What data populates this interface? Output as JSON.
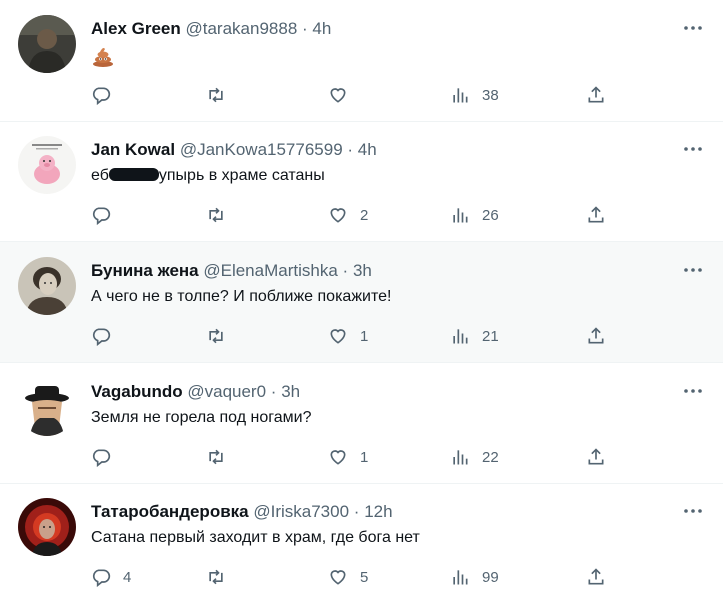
{
  "tweets": [
    {
      "name": "Alex Green",
      "handle": "@tarakan9888",
      "sep": "·",
      "time": "4h",
      "text": "",
      "emoji": "poop-emoji",
      "replies": "",
      "likes": "",
      "views": "38",
      "shaded": false
    },
    {
      "name": "Jan Kowal",
      "handle": "@JanKowa15776599",
      "sep": "·",
      "time": "4h",
      "text_before": "еб",
      "text_after": "упырь в храме сатаны",
      "replies": "",
      "likes": "2",
      "views": "26",
      "shaded": false
    },
    {
      "name": "Бунина жена",
      "handle": "@ElenaMartishka",
      "sep": "·",
      "time": "3h",
      "text": "А чего не в толпе? И поближе покажите!",
      "replies": "",
      "likes": "1",
      "views": "21",
      "shaded": true
    },
    {
      "name": "Vagabundo",
      "handle": "@vaquer0",
      "sep": "·",
      "time": "3h",
      "text": "Земля не горела под ногами?",
      "replies": "",
      "likes": "1",
      "views": "22",
      "shaded": false
    },
    {
      "name": "Татаробандеровка",
      "handle": "@Iriska7300",
      "sep": "·",
      "time": "12h",
      "text": "Сатана первый заходит в храм, где бога нет",
      "replies": "4",
      "likes": "5",
      "views": "99",
      "shaded": false
    }
  ],
  "colors": {
    "text": "#0f1419",
    "muted": "#536471",
    "divider": "#eff3f4",
    "shaded_bg": "#f7f9f9"
  }
}
